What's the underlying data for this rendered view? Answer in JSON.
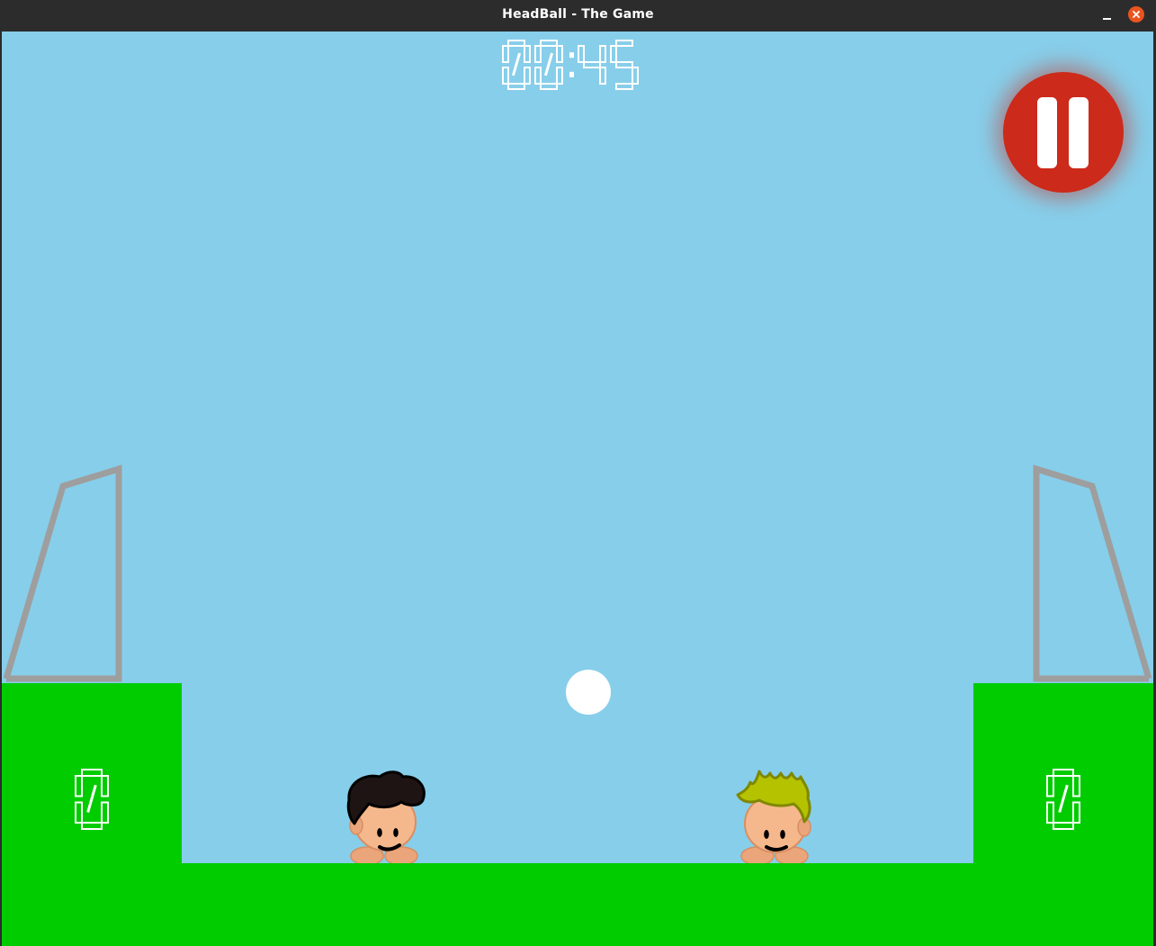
{
  "window": {
    "title": "HeadBall - The Game"
  },
  "hud": {
    "timer": "00:45",
    "left_score": "0",
    "right_score": "0",
    "pause_icon": "pause-icon"
  },
  "colors": {
    "sky": "#87ceea",
    "grass": "#00cc00",
    "goal_frame": "#9e9e9e",
    "pause_button": "#cc2a1a",
    "ball": "#ffffff",
    "digits": "#ffffff",
    "left_player_hair": "#1f1414",
    "right_player_hair": "#b5c200",
    "skin": "#f5b88c"
  }
}
